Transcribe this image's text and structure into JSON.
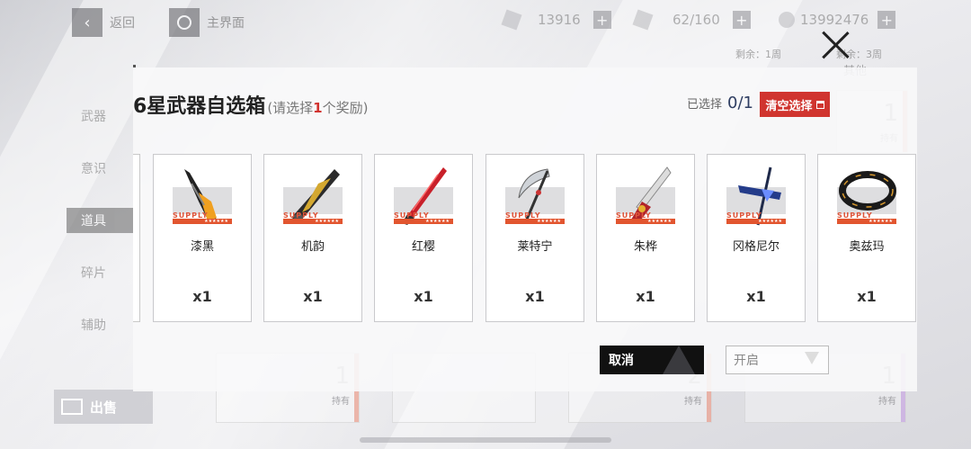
{
  "colors": {
    "accent_red": "#d0352f",
    "supply_orange": "#e2552f",
    "selected_blue": "#2f3e62"
  },
  "topbar": {
    "back_label": "返回",
    "home_label": "主界面",
    "resources": [
      {
        "icon": "battery-icon",
        "value": "13916"
      },
      {
        "icon": "wrench-icon",
        "value": "62/160"
      },
      {
        "icon": "crystal-icon",
        "value": "13992476"
      }
    ]
  },
  "background": {
    "side_nav": [
      "武器",
      "意识",
      "道具",
      "碎片",
      "辅助"
    ],
    "sell_label": "出售",
    "remaining1": "剩余：1周",
    "remaining2": "剩余：3周",
    "other_label": "其他",
    "owned_label": "持有",
    "ghost_counts": [
      "1",
      "1",
      "2",
      "1"
    ]
  },
  "modal": {
    "title": "6星武器自选箱",
    "subtitle_prefix": "(请选择",
    "subtitle_count": "1",
    "subtitle_suffix": "个奖励)",
    "selected_label": "已选择",
    "selected_count": "0/1",
    "clear_label": "清空选择",
    "cancel_label": "取消",
    "open_label": "开启",
    "supply_label": "SUPPLY",
    "supply_stars": "★★★★★★",
    "items": [
      {
        "name": "漆黑",
        "qty": "x1",
        "icon": "black-sword-icon"
      },
      {
        "name": "机韵",
        "qty": "x1",
        "icon": "mech-blade-icon"
      },
      {
        "name": "红樱",
        "qty": "x1",
        "icon": "red-katana-icon"
      },
      {
        "name": "莱特宁",
        "qty": "x1",
        "icon": "scythe-icon"
      },
      {
        "name": "朱桦",
        "qty": "x1",
        "icon": "crimson-blade-icon"
      },
      {
        "name": "冈格尼尔",
        "qty": "x1",
        "icon": "lance-icon"
      },
      {
        "name": "奥兹玛",
        "qty": "x1",
        "icon": "ring-icon"
      }
    ]
  }
}
